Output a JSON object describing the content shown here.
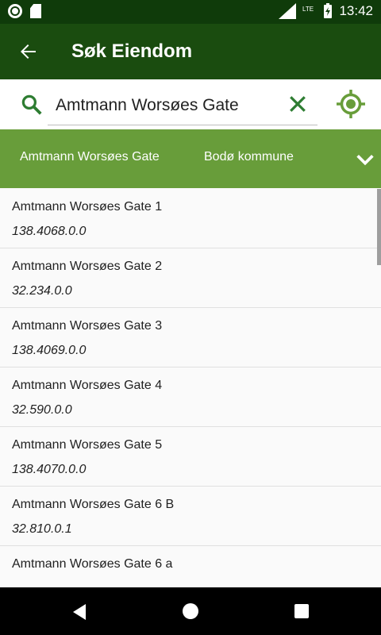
{
  "status_bar": {
    "time": "13:42",
    "network": "LTE"
  },
  "app_bar": {
    "title": "Søk Eiendom"
  },
  "search": {
    "value": "Amtmann Worsøes Gate"
  },
  "filter": {
    "street": "Amtmann Worsøes Gate",
    "kommune": "Bodø kommune"
  },
  "colors": {
    "status_bar": "#0f3b0a",
    "app_bar": "#1a4c0f",
    "accent": "#689d3a",
    "icon_green": "#2e7d32"
  },
  "results": [
    {
      "title": "Amtmann Worsøes Gate 1",
      "sub": "138.4068.0.0"
    },
    {
      "title": "Amtmann Worsøes Gate 2",
      "sub": "32.234.0.0"
    },
    {
      "title": "Amtmann Worsøes Gate 3",
      "sub": "138.4069.0.0"
    },
    {
      "title": "Amtmann Worsøes Gate 4",
      "sub": "32.590.0.0"
    },
    {
      "title": "Amtmann Worsøes Gate 5",
      "sub": "138.4070.0.0"
    },
    {
      "title": "Amtmann Worsøes Gate 6 B",
      "sub": "32.810.0.1"
    },
    {
      "title": "Amtmann Worsøes Gate 6 a",
      "sub": ""
    }
  ]
}
